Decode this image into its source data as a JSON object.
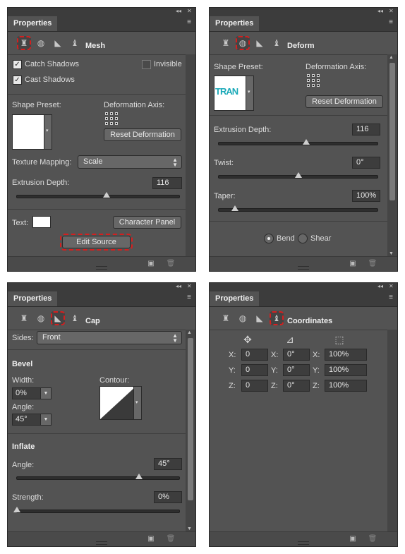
{
  "panel_common": {
    "tab_label": "Properties",
    "collapse_glyph": "◂◂",
    "close_glyph": "✕",
    "menu_glyph": "≡",
    "toolbar_glyphs": [
      "♜",
      "◍",
      "◣",
      "♝"
    ],
    "footer_glyph_render": "▣",
    "footer_glyph_delete": "🗑"
  },
  "mesh": {
    "section_title": "Mesh",
    "catch_shadows": "Catch Shadows",
    "invisible": "Invisible",
    "cast_shadows": "Cast Shadows",
    "shape_preset": "Shape Preset:",
    "deformation_axis": "Deformation Axis:",
    "reset_deformation": "Reset Deformation",
    "texture_mapping_label": "Texture Mapping:",
    "texture_mapping_value": "Scale",
    "extrusion_depth_label": "Extrusion Depth:",
    "extrusion_depth_value": "116",
    "extrusion_slider_fraction": 0.55,
    "text_label": "Text:",
    "character_panel": "Character Panel",
    "edit_source": "Edit Source"
  },
  "deform": {
    "section_title": "Deform",
    "shape_preset": "Shape Preset:",
    "preset_text": "TRAN",
    "deformation_axis": "Deformation Axis:",
    "reset_deformation": "Reset Deformation",
    "extrusion_depth_label": "Extrusion Depth:",
    "extrusion_depth_value": "116",
    "extrusion_slider_fraction": 0.55,
    "twist_label": "Twist:",
    "twist_value": "0°",
    "twist_slider_fraction": 0.5,
    "taper_label": "Taper:",
    "taper_value": "100%",
    "taper_slider_fraction": 0.1,
    "bend": "Bend",
    "shear": "Shear"
  },
  "cap": {
    "section_title": "Cap",
    "sides_label": "Sides:",
    "sides_value": "Front",
    "bevel_heading": "Bevel",
    "width_label": "Width:",
    "width_value": "0%",
    "contour_label": "Contour:",
    "angle_label": "Angle:",
    "angle_value": "45°",
    "inflate_heading": "Inflate",
    "inflate_angle_label": "Angle:",
    "inflate_angle_value": "45°",
    "inflate_angle_fraction": 0.75,
    "strength_label": "Strength:",
    "strength_value": "0%",
    "strength_fraction": 0.0
  },
  "coordinates": {
    "section_title": "Coordinates",
    "move_glyph": "✥",
    "rotate_glyph": "⊿",
    "scale_glyph": "⬚",
    "rows": [
      {
        "axis": "X:",
        "pos": "0",
        "rot_axis": "X:",
        "rot": "0°",
        "scale_axis": "X:",
        "scale": "100%"
      },
      {
        "axis": "Y:",
        "pos": "0",
        "rot_axis": "Y:",
        "rot": "0°",
        "scale_axis": "Y:",
        "scale": "100%"
      },
      {
        "axis": "Z:",
        "pos": "0",
        "rot_axis": "Z:",
        "rot": "0°",
        "scale_axis": "Z:",
        "scale": "100%"
      }
    ]
  },
  "accent_color": "#d41f1f"
}
